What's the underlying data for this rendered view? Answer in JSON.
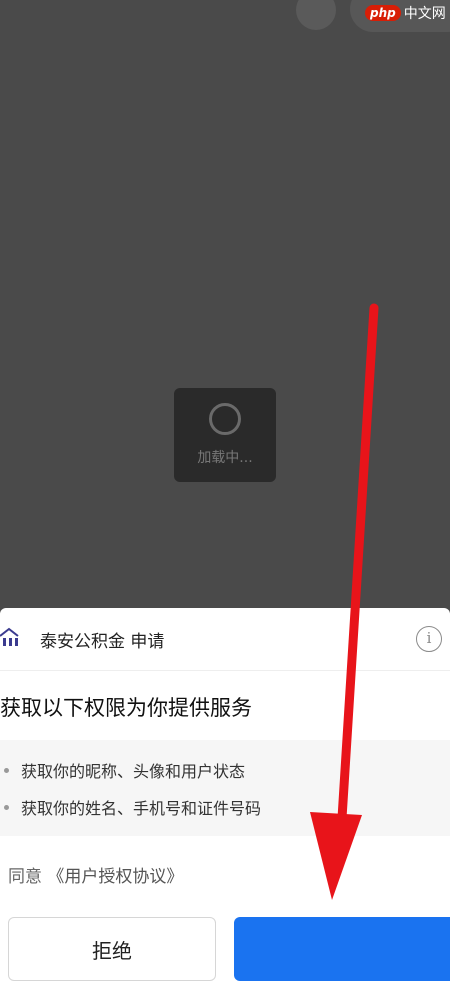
{
  "watermark": {
    "badge": "php",
    "text": "中文网"
  },
  "loading": {
    "text": "加载中..."
  },
  "sheet": {
    "app_name": "泰安公积金 申请",
    "title": "获取以下权限为你提供服务",
    "permissions": [
      "获取你的昵称、头像和用户状态",
      "获取你的姓名、手机号和证件号码"
    ],
    "agree_prefix": "同意",
    "agree_link": "《用户授权协议》",
    "reject_label": "拒绝",
    "allow_label": ""
  },
  "colors": {
    "overlay": "#4a4a4a",
    "primary_blue": "#1a73f0",
    "arrow_red": "#e8141a"
  }
}
